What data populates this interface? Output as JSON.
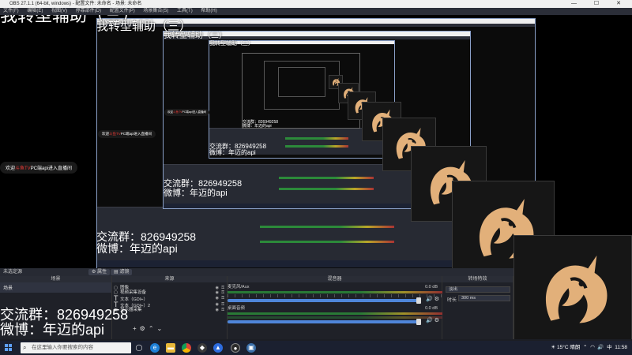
{
  "window": {
    "title": "OBS 27.1.1 (64-bit, windows) - 配置文件: 未命名 - 场景: 未命名",
    "controls": "—  ☐  ✕"
  },
  "menu": [
    "文件(F)",
    "编辑(E)",
    "视图(V)",
    "停靠部件(D)",
    "配置文件(P)",
    "场景集合(S)",
    "工具(T)",
    "帮助(H)"
  ],
  "captions": {
    "heading": "我转型辅助（三）",
    "welcome_prefix": "欢迎",
    "welcome_red": "斗鱼TV",
    "welcome_suffix": "PC端api进入直播间",
    "qq_group": "交流群：826949258",
    "weibo": "微博：年迈的api"
  },
  "dock_header": {
    "label": "未选定源",
    "props_button": "属性",
    "filters_button": "滤镜"
  },
  "docks": {
    "scenes": {
      "title": "场景",
      "items": [
        "场景"
      ]
    },
    "sources": {
      "title": "来源",
      "items": [
        {
          "icon": "▢",
          "label": "图像"
        },
        {
          "icon": "▢",
          "label": "视频采集设备"
        },
        {
          "icon": "T",
          "label": "文本（GDI+）"
        },
        {
          "icon": "T",
          "label": "文本（GDI+）2"
        },
        {
          "icon": "▣",
          "label": "显示器采集"
        }
      ]
    },
    "mixer": {
      "title": "混音器",
      "channels": [
        {
          "name": "麦克风/Aux",
          "db": "0.0 dB"
        },
        {
          "name": "桌面音频",
          "db": "0.0 dB"
        }
      ]
    },
    "transitions": {
      "title": "转场特效",
      "mode": "淡出",
      "duration_label": "时长",
      "duration_value": "300 ms"
    }
  },
  "taskbar": {
    "search_placeholder": "在这里输入你要搜索的内容",
    "weather": "15°C",
    "weather_desc": "晴朗",
    "tray_time": "11:58",
    "tray_lang": "中"
  }
}
